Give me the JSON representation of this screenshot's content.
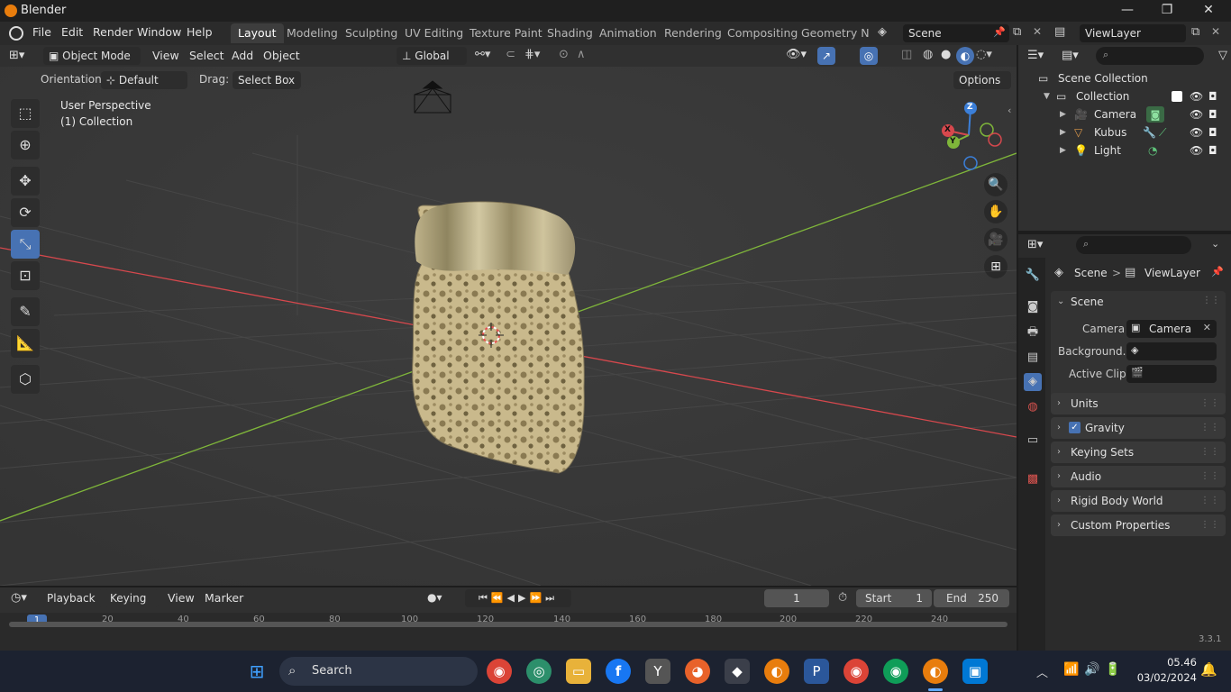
{
  "title_bar": {
    "app_title": "Blender",
    "minimize": "—",
    "maximize": "❐",
    "close": "✕"
  },
  "menu": {
    "items": [
      "File",
      "Edit",
      "Render",
      "Window",
      "Help"
    ],
    "workspace_tabs": [
      "Layout",
      "Modeling",
      "Sculpting",
      "UV Editing",
      "Texture Paint",
      "Shading",
      "Animation",
      "Rendering",
      "Compositing",
      "Geometry Noc"
    ],
    "active_tab": "Layout",
    "scene_name": "Scene",
    "view_layer": "ViewLayer"
  },
  "viewport_header": {
    "mode": "Object Mode",
    "menus": [
      "View",
      "Select",
      "Add",
      "Object"
    ],
    "transform_orientation": "Global"
  },
  "tool_settings": {
    "orientation_label": "Orientation:",
    "orientation_value": "Default",
    "drag_label": "Drag:",
    "drag_value": "Select Box",
    "options": "Options"
  },
  "viewport": {
    "perspective_label": "User Perspective",
    "collection_label": "(1) Collection",
    "gizmo_axes": [
      "X",
      "Y",
      "Z"
    ]
  },
  "timeline": {
    "menus": [
      "Playback",
      "Keying",
      "View",
      "Marker"
    ],
    "current_frame": "1",
    "start_label": "Start",
    "start_value": "1",
    "end_label": "End",
    "end_value": "250",
    "ruler_ticks": [
      "1",
      "20",
      "40",
      "60",
      "80",
      "100",
      "120",
      "140",
      "160",
      "180",
      "200",
      "220",
      "240"
    ]
  },
  "outliner": {
    "scene_collection": "Scene Collection",
    "collection": "Collection",
    "items": [
      "Camera",
      "Kubus",
      "Light"
    ]
  },
  "properties": {
    "breadcrumb_scene": "Scene",
    "breadcrumb_separator": ">",
    "breadcrumb_layer": "ViewLayer",
    "scene_panel": "Scene",
    "camera_label": "Camera",
    "camera_value": "Camera",
    "background_label": "Background...",
    "active_clip_label": "Active Clip",
    "panels": [
      "Units",
      "Gravity",
      "Keying Sets",
      "Audio",
      "Rigid Body World",
      "Custom Properties"
    ],
    "gravity_checked": true
  },
  "status_bar": {
    "version": "3.3.1"
  },
  "taskbar": {
    "search_label": "Search",
    "time": "05.46",
    "date": "03/02/2024"
  },
  "colors": {
    "accent": "#4772b3",
    "x_axis": "#d6484d",
    "y_axis": "#7fb63a",
    "z_axis": "#3b7fd9"
  }
}
